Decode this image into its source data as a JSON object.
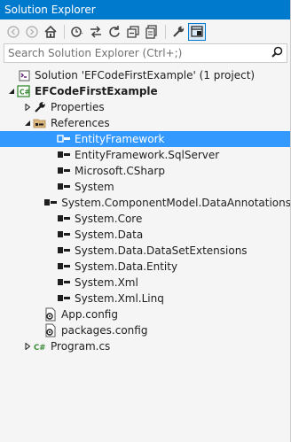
{
  "window": {
    "title": "Solution Explorer"
  },
  "toolbar": {
    "buttons": [
      {
        "icon": "back-icon"
      },
      {
        "icon": "forward-icon"
      },
      {
        "icon": "home-icon"
      },
      {
        "icon": "history-icon"
      },
      {
        "icon": "sync-icon"
      },
      {
        "icon": "refresh-icon"
      },
      {
        "icon": "collapse-all-icon"
      },
      {
        "icon": "show-files-icon"
      },
      {
        "icon": "properties-icon"
      },
      {
        "icon": "preview-icon"
      }
    ]
  },
  "search": {
    "placeholder": "Search Solution Explorer (Ctrl+;)"
  },
  "tree": {
    "solution": "Solution 'EFCodeFirstExample' (1 project)",
    "project": "EFCodeFirstExample",
    "properties": "Properties",
    "references": "References",
    "refs": [
      "EntityFramework",
      "EntityFramework.SqlServer",
      "Microsoft.CSharp",
      "System",
      "System.ComponentModel.DataAnnotations",
      "System.Core",
      "System.Data",
      "System.Data.DataSetExtensions",
      "System.Data.Entity",
      "System.Xml",
      "System.Xml.Linq"
    ],
    "files": [
      "App.config",
      "packages.config",
      "Program.cs"
    ]
  },
  "colors": {
    "accent": "#007acc",
    "selection": "#3399ff"
  }
}
